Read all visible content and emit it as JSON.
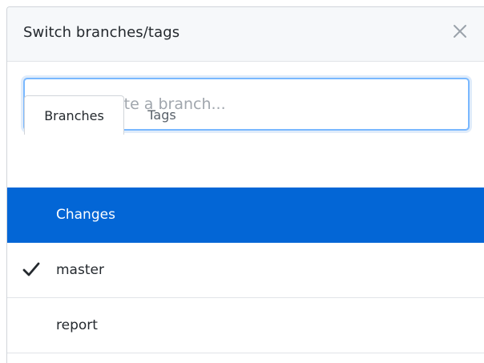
{
  "header": {
    "title": "Switch branches/tags",
    "close_icon": "close-icon"
  },
  "search": {
    "value": "",
    "placeholder": "Find or create a branch..."
  },
  "tabs": [
    {
      "label": "Branches",
      "active": true
    },
    {
      "label": "Tags",
      "active": false
    }
  ],
  "branches": [
    {
      "name": "Changes",
      "selected": true,
      "checked": false
    },
    {
      "name": "master",
      "selected": false,
      "checked": true
    },
    {
      "name": "report",
      "selected": false,
      "checked": false
    }
  ],
  "colors": {
    "accent": "#0366d6",
    "focus_ring": "#79b8ff",
    "header_bg": "#f6f8fa"
  }
}
